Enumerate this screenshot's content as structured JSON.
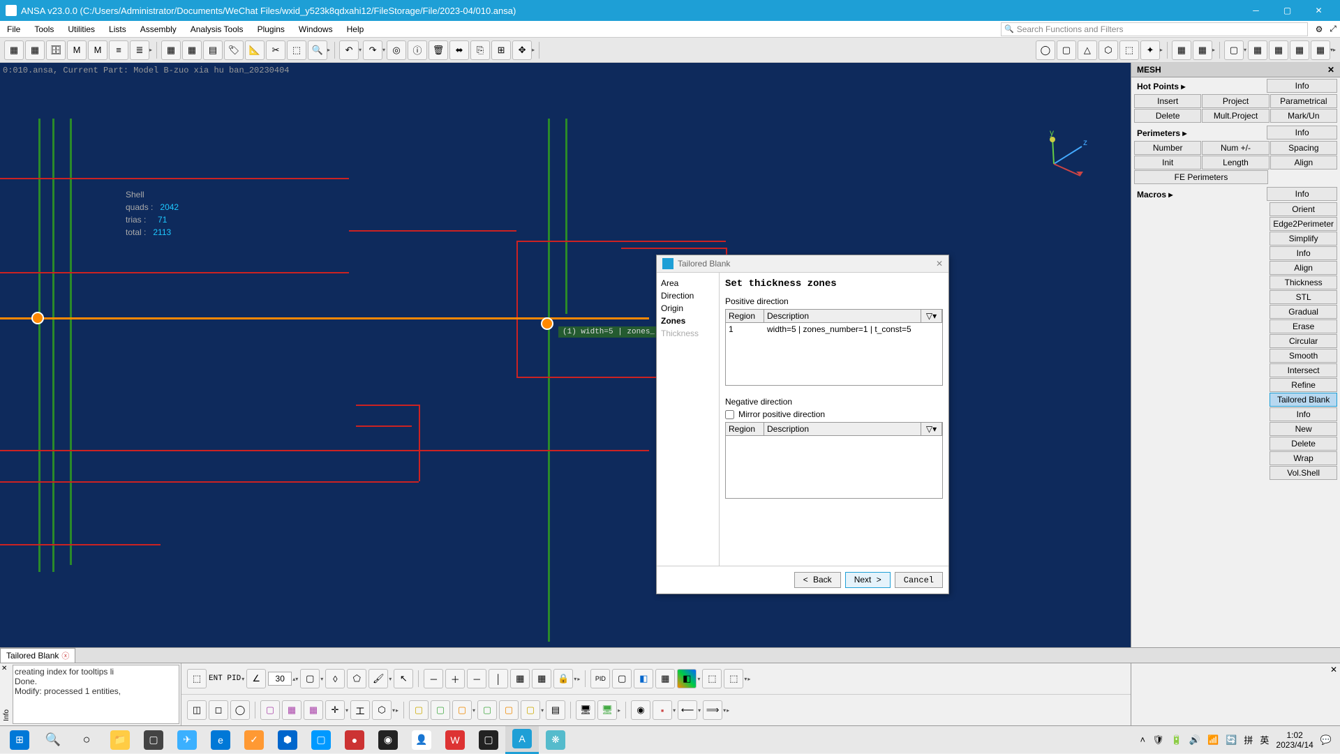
{
  "window": {
    "title": "ANSA v23.0.0 (C:/Users/Administrator/Documents/WeChat Files/wxid_y523k8qdxahi12/FileStorage/File/2023-04/010.ansa)"
  },
  "menus": [
    "File",
    "Tools",
    "Utilities",
    "Lists",
    "Assembly",
    "Analysis Tools",
    "Plugins",
    "Windows",
    "Help"
  ],
  "search": {
    "placeholder": "Search Functions and Filters"
  },
  "viewport": {
    "info": "0:010.ansa,  Current Part: Model B-zuo xia hu ban_20230404",
    "stats_label": "Shell",
    "quads_label": "quads :",
    "quads": "2042",
    "trias_label": "trias :",
    "trias": "71",
    "total_label": "total :",
    "total": "2113",
    "marker_label": "(1) width=5 | zones_"
  },
  "right_panel": {
    "title": "MESH",
    "hotpoints": {
      "title": "Hot Points ▸",
      "info": "Info",
      "insert": "Insert",
      "project": "Project",
      "param": "Parametrical",
      "delete": "Delete",
      "multproject": "Mult.Project",
      "markun": "Mark/Un"
    },
    "perimeters": {
      "title": "Perimeters ▸",
      "info": "Info",
      "number": "Number",
      "numplus": "Num +/-",
      "spacing": "Spacing",
      "init": "Init",
      "length": "Length",
      "align": "Align",
      "fe": "FE Perimeters"
    },
    "macros": {
      "title": "Macros ▸",
      "info": "Info",
      "orient": "Orient",
      "edge2perim": "Edge2Perimeter",
      "simplify": "Simplify",
      "info2": "Info",
      "align": "Align",
      "thickness": "Thickness",
      "stl": "STL",
      "gradual": "Gradual",
      "erase": "Erase",
      "circular": "Circular",
      "smooth": "Smooth",
      "intersect": "Intersect",
      "refine": "Refine",
      "tailored": "Tailored Blank",
      "info3": "Info",
      "new": "New",
      "delete": "Delete",
      "wrap": "Wrap",
      "volshell": "Vol.Shell"
    }
  },
  "dialog": {
    "title": "Tailored Blank",
    "nav": {
      "area": "Area",
      "direction": "Direction",
      "origin": "Origin",
      "zones": "Zones",
      "thickness": "Thickness"
    },
    "heading": "Set thickness zones",
    "pos_label": "Positive direction",
    "neg_label": "Negative direction",
    "mirror": "Mirror positive direction",
    "col_region": "Region",
    "col_desc": "Description",
    "filter_icon": "▽▾",
    "row1_region": "1",
    "row1_desc": "width=5 | zones_number=1 | t_const=5",
    "back": "Back",
    "next": "Next",
    "cancel": "Cancel"
  },
  "bottom_tab": {
    "label": "Tailored Blank"
  },
  "console": {
    "line1": "creating index for tooltips li",
    "line2": "Done.",
    "line3": "Modify: processed 1 entities,",
    "side": "Info"
  },
  "ent_row": {
    "label": "ENT PID",
    "angle": "30"
  },
  "taskbar": {
    "time": "1:02",
    "date": "2023/4/14",
    "ime1": "拼",
    "ime2": "英"
  }
}
